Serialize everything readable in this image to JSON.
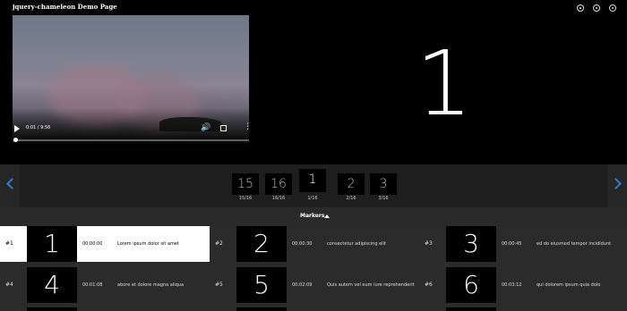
{
  "page": {
    "title": "jquery-chameleon Demo Page"
  },
  "top_controls": [
    "circle-button",
    "circle-button",
    "circle-button"
  ],
  "player": {
    "time": "0:01 / 9:56",
    "progress_fraction": 0.003,
    "current_slide": "1"
  },
  "strip": {
    "thumbs": [
      {
        "number": "15",
        "label": "15/16"
      },
      {
        "number": "16",
        "label": "16/16"
      },
      {
        "number": "1",
        "label": "1/16",
        "active": true
      },
      {
        "number": "2",
        "label": "2/16"
      },
      {
        "number": "3",
        "label": "3/16"
      }
    ]
  },
  "markers": {
    "title": "Markers",
    "items": [
      {
        "id": "#1",
        "number": "1",
        "time": "00:00:00",
        "text": "Lorem ipsum dolor sit amet",
        "active": true
      },
      {
        "id": "#2",
        "number": "2",
        "time": "00:00:30",
        "text": "consectetur adipiscing elit"
      },
      {
        "id": "#3",
        "number": "3",
        "time": "00:00:45",
        "text": "ed do eiusmod tempor incididunt"
      },
      {
        "id": "#4",
        "number": "4",
        "time": "00:01:08",
        "text": "abore et dolore magna aliqua"
      },
      {
        "id": "#5",
        "number": "5",
        "time": "00:02:09",
        "text": "Quis autem vel eum iure reprehenderit"
      },
      {
        "id": "#6",
        "number": "6",
        "time": "00:03:12",
        "text": "qui dolorem ipsum quia dolo"
      }
    ]
  },
  "colors": {
    "accent": "#3a78c8",
    "background": "#000000",
    "panel": "#2b2b2b"
  }
}
